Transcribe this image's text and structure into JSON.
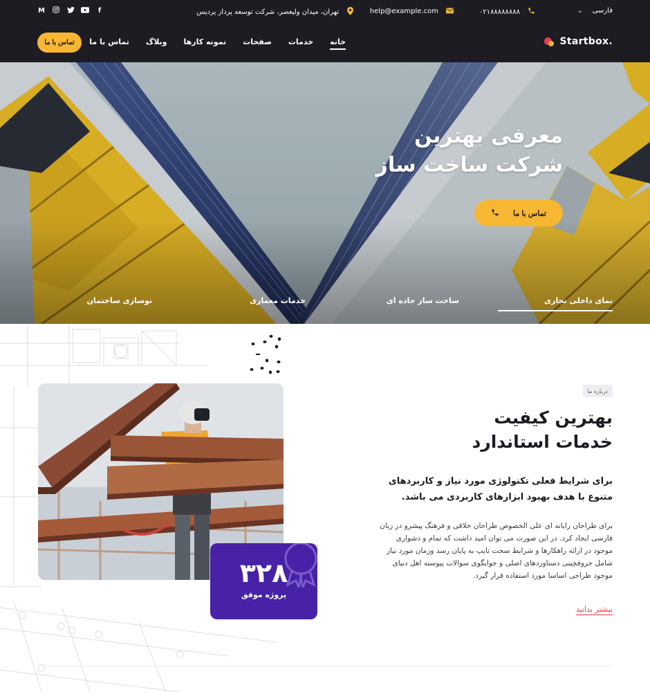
{
  "topbar": {
    "language": "فارسی",
    "phone": "۰۲۱۸۸۸۸۸۸۸۸",
    "email": "help@example.com",
    "address": "تهران، میدان ولیعصر، شرکت توسعه پرداز پردیس",
    "socials": [
      "facebook-icon",
      "youtube-icon",
      "twitter-icon",
      "instagram-icon",
      "medium-icon"
    ]
  },
  "nav": {
    "logo": "Startbox.",
    "items": [
      "خانه",
      "خدمات",
      "صفحات",
      "نمونه کارها",
      "وبلاگ",
      "تماس با ما"
    ],
    "active_index": 0,
    "cta": "تماس با ما"
  },
  "hero": {
    "title_line1": "معرفی بهترین",
    "title_line2": "شرکت ساخت ساز",
    "cta": "تماس با ما",
    "tabs": [
      "نمای داخلی تجاری",
      "ساخت ساز جاده ای",
      "خدمات معماری",
      "نوسازی ساختمان"
    ],
    "active_tab": 0
  },
  "about": {
    "badge": "درباره ما",
    "title_line1": "بهترین کیفیت",
    "title_line2": "خدمات استاندارد",
    "lead": "برای شرایط فعلی تکنولوژی مورد نیاز و کاربردهای متنوع با هدف بهبود ابزارهای کاربردی می باشد.",
    "body": "برای طراحان رایانه ای علی الخصوص طراحان خلاقی و فرهنگ پیشرو در زبان فارسی ایجاد کرد. در این صورت می توان امید داشت که تمام و دشواری موجود در ارائه راهکارها و شرایط سخت تایپ به پایان رسد وزمان مورد نیاز شامل حروفچینی دستاوردهای اصلی و جوابگوی سوالات پیوسته اهل دنیای موجود طراحی اساسا مورد استفاده قرار گیرد.",
    "more_link": "بیشتر بدانید",
    "stat_number": "۳۲۸",
    "stat_label": "پروژه موفق"
  },
  "colors": {
    "header_bg": "#1c1c22",
    "accent_yellow": "#f7b733",
    "stat_purple": "#4721a6",
    "link_red": "#e83a4d"
  }
}
